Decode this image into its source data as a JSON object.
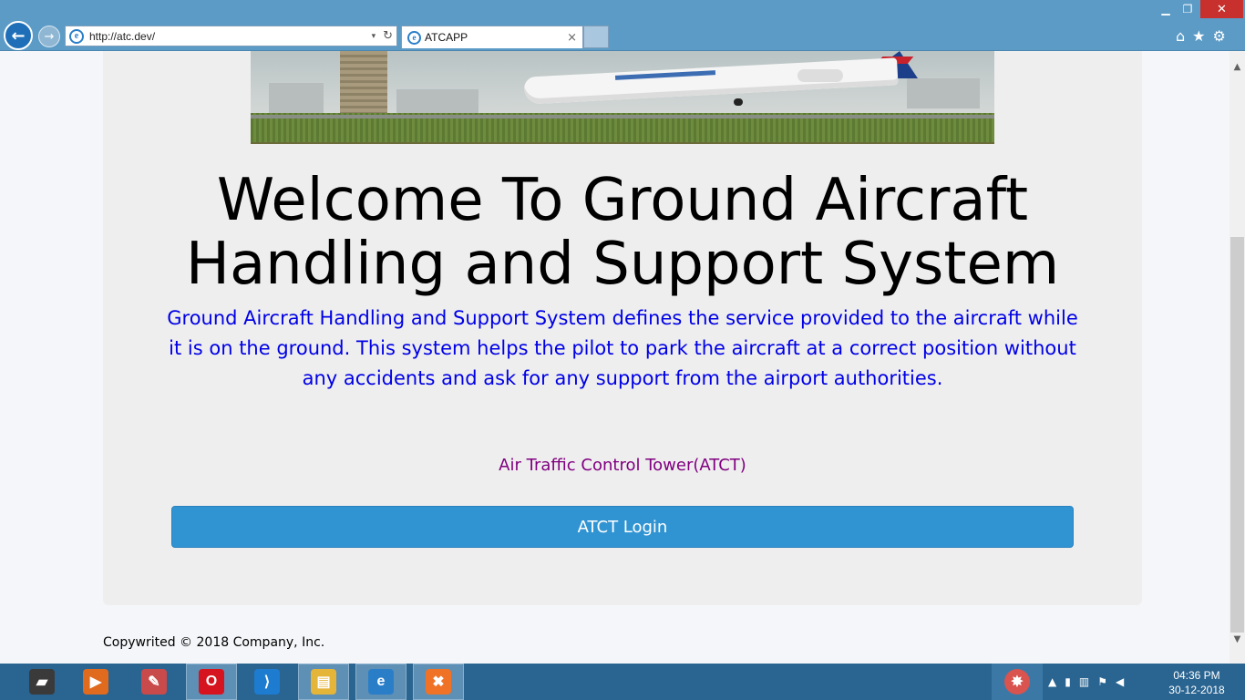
{
  "browser": {
    "url": "http://atc.dev/",
    "tab_title": "ATCAPP",
    "tab_close": "×",
    "back_glyph": "←",
    "forward_glyph": "→",
    "refresh_glyph": "↻",
    "dropdown_glyph": "▾",
    "ie_glyph": "e",
    "window_controls": {
      "minimize": "▁",
      "maximize": "❐",
      "close": "✕"
    },
    "tools": {
      "home": "⌂",
      "favorites": "★",
      "settings": "⚙"
    }
  },
  "page": {
    "heading": "Welcome To Ground Aircraft Handling and Support System",
    "description": "Ground Aircraft Handling and Support System defines the service provided to the aircraft while it is on the ground. This system helps the pilot to park the aircraft at a correct position without any accidents and ask for any support from the airport authorities.",
    "atct_label": "Air Traffic Control Tower(ATCT)",
    "login_button": "ATCT Login",
    "footer": "Copywrited © 2018 Company, Inc."
  },
  "scrollbar": {
    "up": "▲",
    "down": "▼"
  },
  "taskbar": {
    "apps": [
      {
        "name": "laptop-icon",
        "glyph": "▰",
        "color": "#3a3a3a"
      },
      {
        "name": "media-player-icon",
        "glyph": "▶",
        "color": "#e06a1e"
      },
      {
        "name": "paint-icon",
        "glyph": "✎",
        "color": "#c94a4a"
      },
      {
        "name": "opera-icon",
        "glyph": "O",
        "color": "#d5141f"
      },
      {
        "name": "vscode-icon",
        "glyph": "⟩",
        "color": "#1d7ccf"
      },
      {
        "name": "file-explorer-icon",
        "glyph": "▤",
        "color": "#e5b53a"
      },
      {
        "name": "internet-explorer-icon",
        "glyph": "e",
        "color": "#2a7ec8"
      },
      {
        "name": "xampp-icon",
        "glyph": "✖",
        "color": "#f07226"
      }
    ],
    "tray": {
      "expand": "▲",
      "battery": "▮",
      "network": "▥",
      "flag": "⚑",
      "volume": "◀"
    },
    "notification_glyph": "✸",
    "clock_time": "04:36 PM",
    "clock_date": "30-12-2018"
  },
  "colors": {
    "chrome": "#5b9bc6",
    "jumbotron": "#eeeeee",
    "description_text": "#0000e6",
    "atct_label": "#800080",
    "login_button": "#3194d2",
    "taskbar": "#2a6490"
  }
}
